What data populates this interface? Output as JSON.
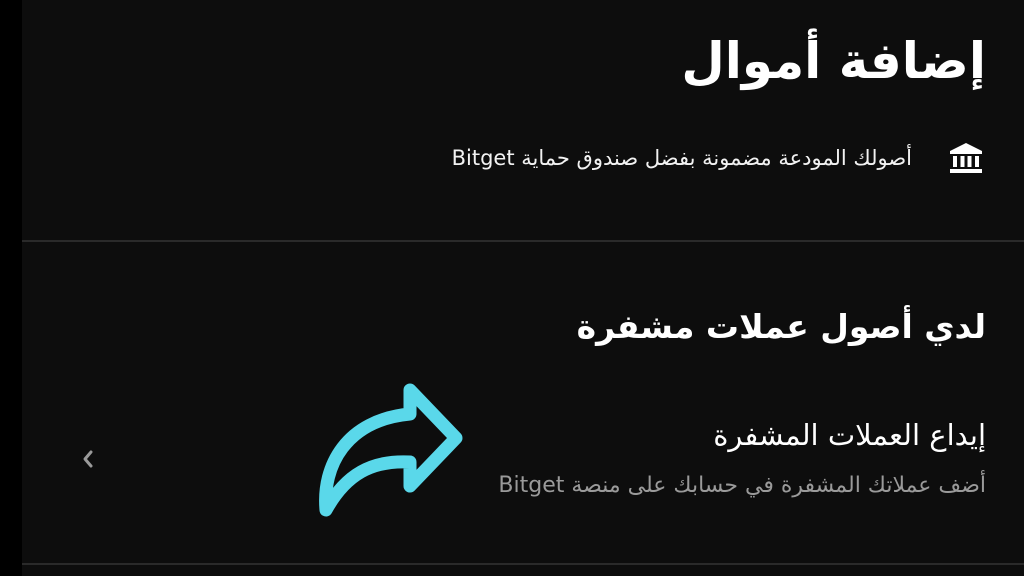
{
  "header": {
    "title": "إضافة أموال"
  },
  "info": {
    "text": "أصولك المودعة مضمونة بفضل صندوق حماية Bitget",
    "icon": "bank-icon"
  },
  "section": {
    "heading": "لدي أصول عملات مشفرة"
  },
  "deposit": {
    "title": "إيداع العملات المشفرة",
    "subtitle": "أضف عملاتك المشفرة في حسابك على منصة Bitget",
    "chevron_icon": "chevron-left-icon"
  },
  "overlay": {
    "icon": "share-arrow-icon",
    "color": "#5ad8ea"
  }
}
